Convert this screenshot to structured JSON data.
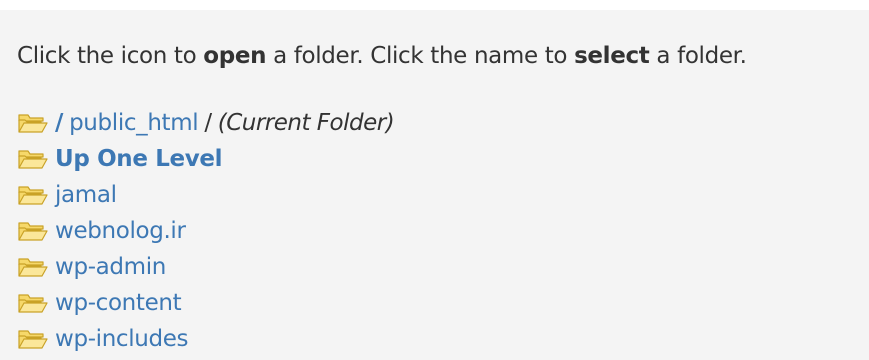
{
  "instructions": {
    "text_1": "Click the icon to ",
    "bold_1": "open",
    "text_2": " a folder. Click the name to ",
    "bold_2": "select",
    "text_3": " a folder."
  },
  "current_path": {
    "root_separator": "/",
    "folder_name": "public_html",
    "trailing_separator": "/",
    "current_label": "(Current Folder)"
  },
  "up_level": {
    "label": "Up One Level"
  },
  "folders": [
    {
      "name": "jamal"
    },
    {
      "name": "webnolog.ir"
    },
    {
      "name": "wp-admin"
    },
    {
      "name": "wp-content"
    },
    {
      "name": "wp-includes"
    }
  ],
  "icons": {
    "folder": "open-folder-icon"
  },
  "colors": {
    "link": "#3d78b4",
    "text": "#333333",
    "panel_background": "#f4f4f4",
    "folder_fill": "#f6d86a",
    "folder_stroke": "#c9a227"
  }
}
